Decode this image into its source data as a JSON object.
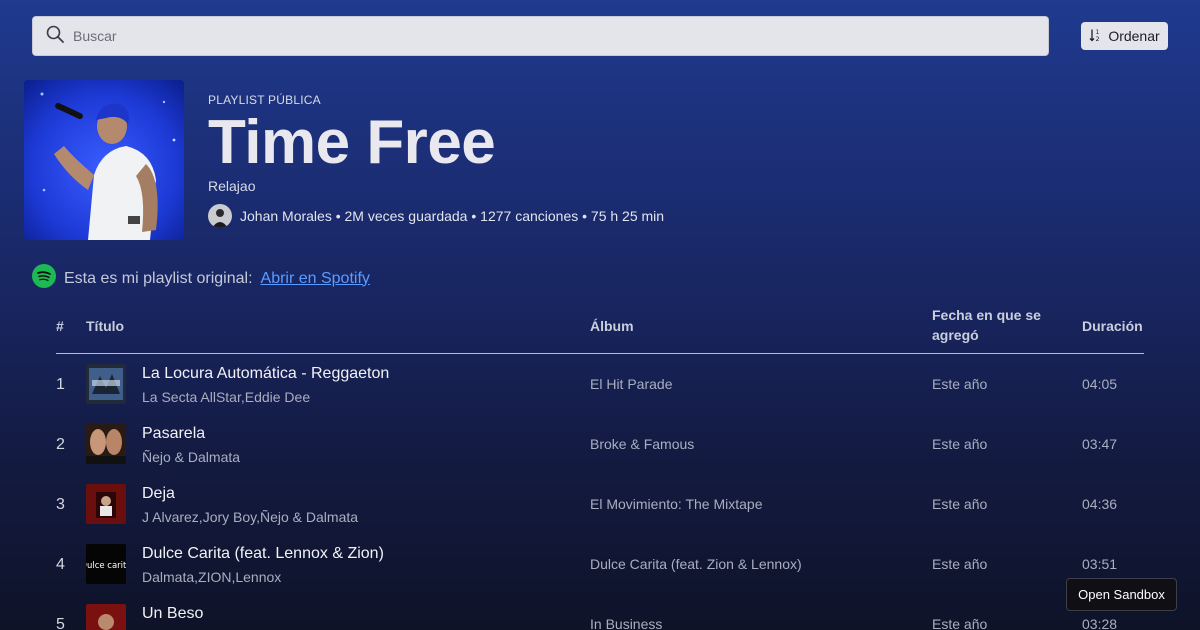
{
  "search": {
    "placeholder": "Buscar"
  },
  "sort": {
    "label": "Ordenar",
    "icon": "sort-ascending-icon"
  },
  "playlist": {
    "eyebrow": "PLAYLIST PÚBLICA",
    "title": "Time Free",
    "description": "Relajao",
    "owner_line": "Johan Morales • 2M veces guardada • 1277 canciones • 75 h 25 min"
  },
  "original": {
    "text": "Esta es mi playlist original:",
    "link_label": "Abrir en Spotify",
    "icon": "spotify-icon",
    "icon_color": "#1db954"
  },
  "columns": {
    "number": "#",
    "title": "Título",
    "album": "Álbum",
    "added_line1": "Fecha en que se",
    "added_line2": "agregó",
    "duration": "Duración"
  },
  "tracks": [
    {
      "number": "1",
      "title": "La Locura Automática - Reggaeton",
      "artists": "La Secta AllStar,Eddie Dee",
      "album": "El Hit Parade",
      "added": "Este año",
      "duration": "04:05"
    },
    {
      "number": "2",
      "title": "Pasarela",
      "artists": "Ñejo & Dalmata",
      "album": "Broke & Famous",
      "added": "Este año",
      "duration": "03:47"
    },
    {
      "number": "3",
      "title": "Deja",
      "artists": "J Alvarez,Jory Boy,Ñejo & Dalmata",
      "album": "El Movimiento: The Mixtape",
      "added": "Este año",
      "duration": "04:36"
    },
    {
      "number": "4",
      "title": "Dulce Carita (feat. Lennox & Zion)",
      "artists": "Dalmata,ZION,Lennox",
      "album": "Dulce Carita (feat. Zion & Lennox)",
      "added": "Este año",
      "duration": "03:51",
      "cover_text": "Dulce carita"
    },
    {
      "number": "5",
      "title": "Un Beso",
      "artists": "",
      "album": "In Business",
      "added": "Este año",
      "duration": "03:28"
    }
  ],
  "sandbox": {
    "label": "Open Sandbox"
  },
  "colors": {
    "accent_link": "#5b9bff",
    "spotify_green": "#1db954"
  }
}
